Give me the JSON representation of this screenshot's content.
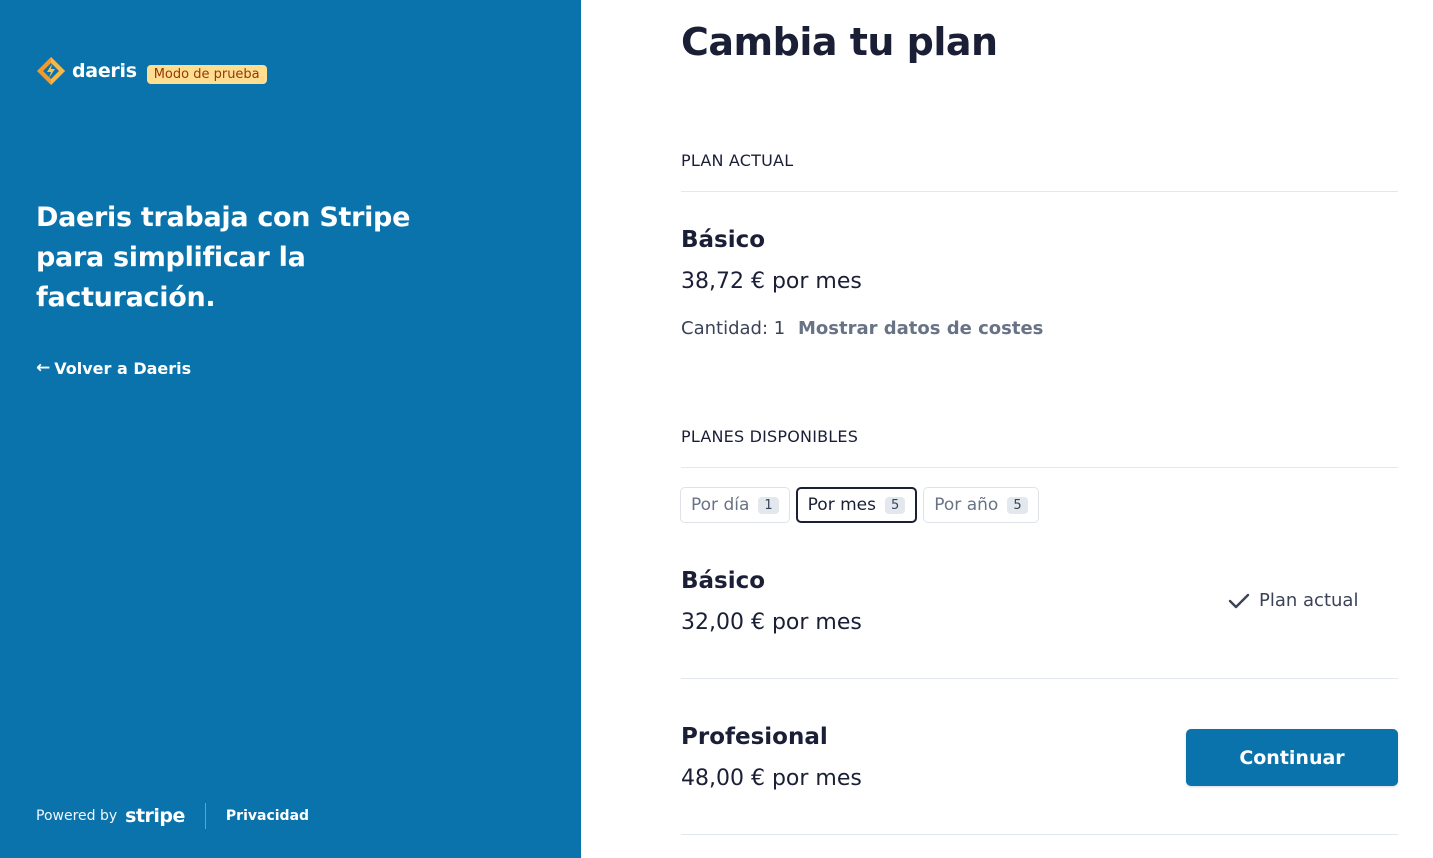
{
  "brand": {
    "name": "daeris",
    "test_mode_badge": "Modo de prueba",
    "accent_color": "#0a73ab",
    "logo_icon": "diamond-lightning-icon"
  },
  "left_panel": {
    "tagline": "Daeris trabaja con Stripe para simplificar la facturación.",
    "back_link": "Volver a Daeris",
    "footer": {
      "powered_by": "Powered by",
      "stripe": "stripe",
      "privacy": "Privacidad"
    }
  },
  "main": {
    "title": "Cambia tu plan",
    "current_plan": {
      "section_label": "PLAN ACTUAL",
      "name": "Básico",
      "price": "38,72 € por mes",
      "quantity": "Cantidad: 1",
      "cost_details_link": "Mostrar datos de costes"
    },
    "available_plans": {
      "section_label": "PLANES DISPONIBLES",
      "tabs": [
        {
          "label": "Por día",
          "count": "1",
          "active": false
        },
        {
          "label": "Por mes",
          "count": "5",
          "active": true
        },
        {
          "label": "Por año",
          "count": "5",
          "active": false
        }
      ],
      "plans": [
        {
          "name": "Básico",
          "price": "32,00 € por mes",
          "status": "Plan actual"
        },
        {
          "name": "Profesional",
          "price": "48,00 € por mes",
          "action": "Continuar"
        }
      ]
    }
  }
}
